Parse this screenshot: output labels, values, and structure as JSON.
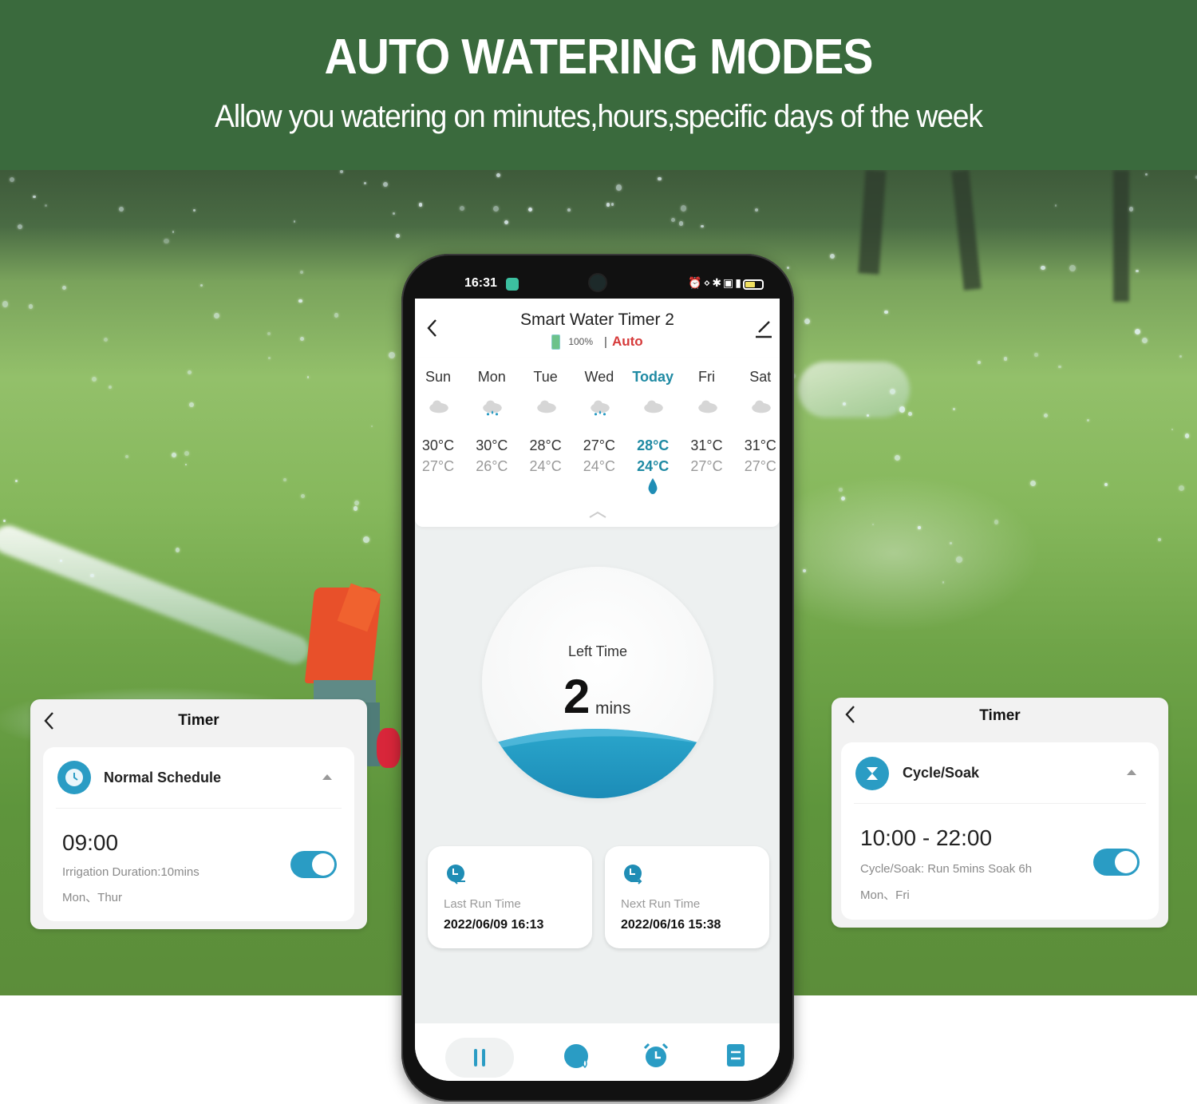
{
  "banner": {
    "title": "AUTO WATERING MODES",
    "subtitle": "Allow you watering on minutes,hours,specific days of the week"
  },
  "colors": {
    "banner_bg": "#3a6a3d",
    "accent": "#2a9cc4",
    "today": "#1f8aa3",
    "auto_red": "#d63a3a"
  },
  "phone": {
    "status_bar": {
      "time": "16:31",
      "icons": [
        "app-notification-icon",
        "alarm-icon",
        "vibrate-icon",
        "bluetooth-icon",
        "hd-icon",
        "5g-signal-icon",
        "battery-icon"
      ]
    },
    "header": {
      "title": "Smart Water Timer 2",
      "battery": "100%",
      "separator": "|",
      "mode": "Auto"
    },
    "weather": [
      {
        "day": "Sun",
        "icon": "cloud-icon",
        "high": "30°C",
        "low": "27°C",
        "today": false
      },
      {
        "day": "Mon",
        "icon": "rain-cloud-icon",
        "high": "30°C",
        "low": "26°C",
        "today": false
      },
      {
        "day": "Tue",
        "icon": "cloud-icon",
        "high": "28°C",
        "low": "24°C",
        "today": false
      },
      {
        "day": "Wed",
        "icon": "rain-cloud-icon",
        "high": "27°C",
        "low": "24°C",
        "today": false
      },
      {
        "day": "Today",
        "icon": "cloud-icon",
        "high": "28°C",
        "low": "24°C",
        "today": true,
        "watering": true
      },
      {
        "day": "Fri",
        "icon": "cloud-icon",
        "high": "31°C",
        "low": "27°C",
        "today": false
      },
      {
        "day": "Sat",
        "icon": "cloud-icon",
        "high": "31°C",
        "low": "27°C",
        "today": false
      }
    ],
    "dial": {
      "label": "Left Time",
      "value": "2",
      "unit": "mins"
    },
    "last_run": {
      "label": "Last Run Time",
      "value": "2022/06/09 16:13"
    },
    "next_run": {
      "label": "Next Run Time",
      "value": "2022/06/16 15:38"
    },
    "tabs": [
      {
        "name": "pause",
        "icon": "pause-icon",
        "active": true
      },
      {
        "name": "watering",
        "icon": "water-drop-circle-icon"
      },
      {
        "name": "timer",
        "icon": "alarm-clock-icon"
      },
      {
        "name": "log",
        "icon": "log-list-icon"
      }
    ]
  },
  "timer_left": {
    "title": "Timer",
    "mode": "Normal Schedule",
    "time": "09:00",
    "detail": "Irrigation Duration:10mins",
    "days": "Mon、Thur",
    "enabled": true
  },
  "timer_right": {
    "title": "Timer",
    "mode": "Cycle/Soak",
    "time": "10:00 - 22:00",
    "detail": "Cycle/Soak: Run 5mins Soak 6h",
    "days": "Mon、Fri",
    "enabled": true
  }
}
